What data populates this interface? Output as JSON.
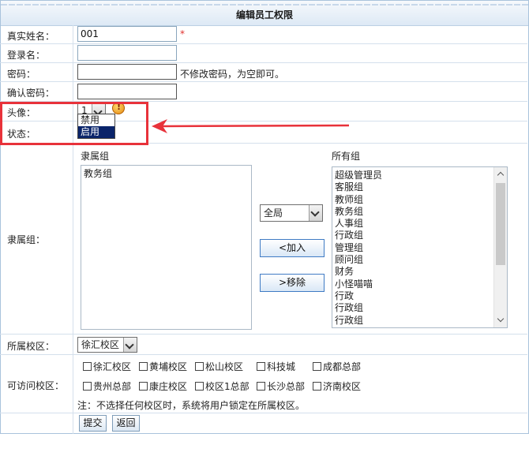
{
  "title": "编辑员工权限",
  "fields": {
    "real_name": {
      "label": "真实姓名：",
      "value": "001",
      "required_mark": "*"
    },
    "login_name": {
      "label": "登录名：",
      "value": ""
    },
    "password": {
      "label": "密码：",
      "value": "",
      "hint": "不修改密码，为空即可。"
    },
    "confirm_password": {
      "label": "确认密码：",
      "value": ""
    },
    "avatar": {
      "label": "头像：",
      "value": "1"
    },
    "status": {
      "label": "状态："
    }
  },
  "status_dropdown": {
    "options": [
      "禁用",
      "启用"
    ],
    "selected": "启用"
  },
  "groups": {
    "label": "隶属组：",
    "member_header": "隶属组",
    "all_header": "所有组",
    "member_items": [
      "教务组"
    ],
    "all_items": [
      "超级管理员",
      "客服组",
      "教师组",
      "教务组",
      "人事组",
      "行政组",
      "管理组",
      "顾问组",
      "财务",
      "小怪喵喵",
      "行政",
      "行政组",
      "行政组"
    ],
    "scope_select": "全局",
    "add_button": "<加入",
    "remove_button": ">移除"
  },
  "campus": {
    "label": "所属校区：",
    "value": "徐汇校区"
  },
  "access_campus": {
    "label": "可访问校区：",
    "row1": [
      "徐汇校区",
      "黄埔校区",
      "松山校区",
      "科技城",
      "成都总部"
    ],
    "row2": [
      "贵州总部",
      "康庄校区",
      "校区1总部",
      "长沙总部",
      "济南校区"
    ],
    "note": "注：不选择任何校区时，系统将用户锁定在所属校区。"
  },
  "actions": {
    "submit": "提交",
    "back": "返回"
  },
  "colors": {
    "highlight_box": "#e8323a",
    "required": "#e0302c",
    "selected_option": "#0a246a"
  }
}
